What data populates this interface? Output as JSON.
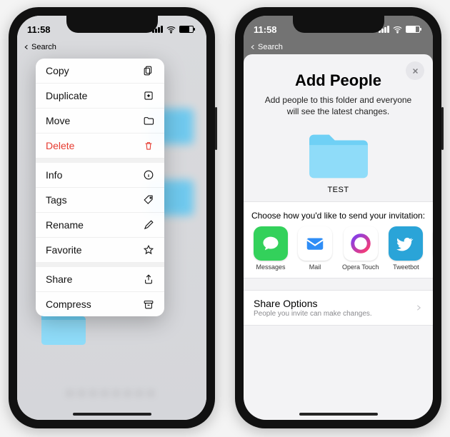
{
  "status": {
    "time": "11:58",
    "back": "Search"
  },
  "phone1": {
    "menu": [
      {
        "name": "copy",
        "label": "Copy",
        "icon": "copy-icon",
        "danger": false,
        "sep": false
      },
      {
        "name": "duplicate",
        "label": "Duplicate",
        "icon": "duplicate-icon",
        "danger": false,
        "sep": false
      },
      {
        "name": "move",
        "label": "Move",
        "icon": "folder-icon",
        "danger": false,
        "sep": false
      },
      {
        "name": "delete",
        "label": "Delete",
        "icon": "trash-icon",
        "danger": true,
        "sep": false
      },
      {
        "name": "info",
        "label": "Info",
        "icon": "info-icon",
        "danger": false,
        "sep": true
      },
      {
        "name": "tags",
        "label": "Tags",
        "icon": "tag-icon",
        "danger": false,
        "sep": false
      },
      {
        "name": "rename",
        "label": "Rename",
        "icon": "pencil-icon",
        "danger": false,
        "sep": false
      },
      {
        "name": "favorite",
        "label": "Favorite",
        "icon": "star-icon",
        "danger": false,
        "sep": false
      },
      {
        "name": "share",
        "label": "Share",
        "icon": "share-icon",
        "danger": false,
        "sep": true
      },
      {
        "name": "compress",
        "label": "Compress",
        "icon": "archive-icon",
        "danger": false,
        "sep": false
      }
    ]
  },
  "phone2": {
    "title": "Add People",
    "subtitle": "Add people to this folder and everyone will see the latest changes.",
    "folder_name": "TEST",
    "invite_prompt": "Choose how you'd like to send your invitation:",
    "apps": [
      {
        "name": "messages",
        "label": "Messages",
        "bg": "#33d15b",
        "icon": "bubble-icon"
      },
      {
        "name": "mail",
        "label": "Mail",
        "bg": "#ffffff",
        "icon": "mail-icon"
      },
      {
        "name": "operatouch",
        "label": "Opera Touch",
        "bg": "#ffffff",
        "icon": "opera-icon"
      },
      {
        "name": "tweetbot",
        "label": "Tweetbot",
        "bg": "#2aa4d8",
        "icon": "bird-icon"
      }
    ],
    "share_options": {
      "title": "Share Options",
      "subtitle": "People you invite can make changes."
    }
  }
}
